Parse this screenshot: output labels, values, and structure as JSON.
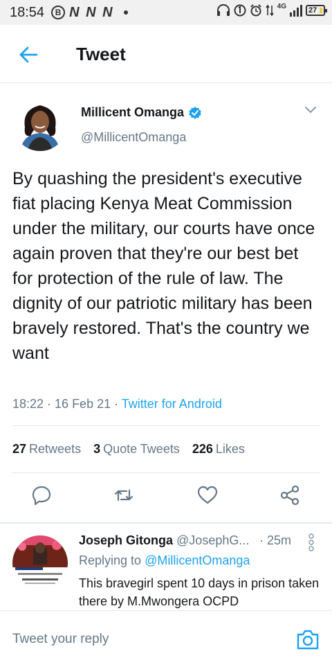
{
  "status_bar": {
    "time": "18:54",
    "b_badge": "B",
    "n_icons": "N N N",
    "network": "4G",
    "battery": "27"
  },
  "header": {
    "back_icon": "back-arrow-icon",
    "title": "Tweet"
  },
  "tweet": {
    "author_name": "Millicent Omanga",
    "handle": "@MillicentOmanga",
    "text": "By quashing the president's executive fiat placing Kenya Meat Commission under the military, our courts have once again proven that they're our best bet for protection of the rule of law. The dignity of our patriotic military has been bravely restored. That's the country we want",
    "time": "18:22 · 16 Feb 21 · ",
    "source": "Twitter for Android",
    "stats": {
      "retweets_count": "27",
      "retweets_label": "Retweets",
      "quotes_count": "3",
      "quotes_label": "Quote Tweets",
      "likes_count": "226",
      "likes_label": "Likes"
    }
  },
  "reply": {
    "name": "Joseph Gitonga",
    "handle": "@JosephG...",
    "time": "· 25m",
    "replying_prefix": "Replying to ",
    "replying_to": "@MillicentOmanga",
    "text": "This bravegirl spent 10 days in prison taken there by M.Mwongera OCPD"
  },
  "composer": {
    "placeholder": "Tweet your reply"
  },
  "colors": {
    "accent": "#1da1f2",
    "secondary_text": "#657786",
    "divider": "#e1e8ed"
  }
}
